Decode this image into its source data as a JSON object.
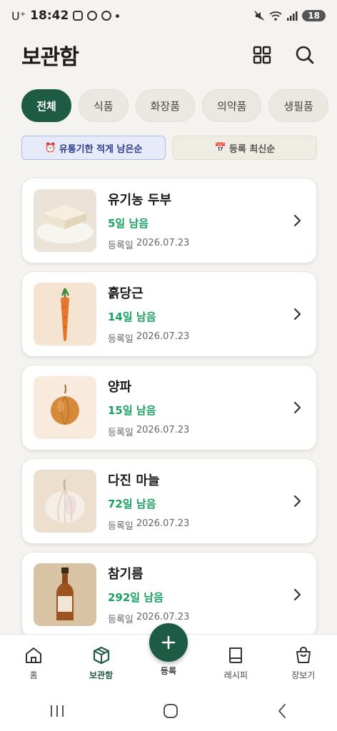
{
  "status_bar": {
    "carrier": "U⁺",
    "time": "18:42",
    "battery": "18"
  },
  "header": {
    "title": "보관함",
    "icons": [
      "grid-icon",
      "search-icon"
    ]
  },
  "categories": [
    {
      "label": "전체",
      "active": true
    },
    {
      "label": "식품",
      "active": false
    },
    {
      "label": "화장품",
      "active": false
    },
    {
      "label": "의약품",
      "active": false
    },
    {
      "label": "생필품",
      "active": false
    }
  ],
  "sort": {
    "expiry": {
      "icon": "⏰",
      "label": "유통기한 적게 남은순",
      "active": true
    },
    "recent": {
      "icon": "📅",
      "label": "등록 최신순",
      "active": false
    }
  },
  "items": [
    {
      "name": "유기농 두부",
      "remaining": "5일 남음",
      "reg_label": "등록일",
      "reg_date": "2026.07.23",
      "image": "tofu"
    },
    {
      "name": "흙당근",
      "remaining": "14일 남음",
      "reg_label": "등록일",
      "reg_date": "2026.07.23",
      "image": "carrot"
    },
    {
      "name": "양파",
      "remaining": "15일 남음",
      "reg_label": "등록일",
      "reg_date": "2026.07.23",
      "image": "onion"
    },
    {
      "name": "다진 마늘",
      "remaining": "72일 남음",
      "reg_label": "등록일",
      "reg_date": "2026.07.23",
      "image": "garlic"
    },
    {
      "name": "참기름",
      "remaining": "292일 남음",
      "reg_label": "등록일",
      "reg_date": "2026.07.23",
      "image": "sesame-oil"
    }
  ],
  "bottom_nav": {
    "home": "홈",
    "storage": "보관함",
    "register": "등록",
    "recipe": "레시피",
    "shopping": "장보기"
  },
  "colors": {
    "accent": "#1e5b45",
    "remaining_green": "#1aa062",
    "sort_active_bg": "#e7ebf9"
  }
}
